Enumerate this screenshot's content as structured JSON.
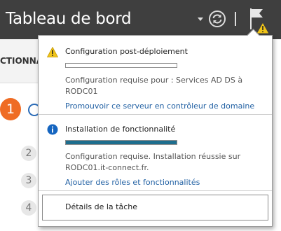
{
  "header": {
    "title": "Tableau de bord",
    "icons": [
      "dropdown-arrow",
      "refresh-icon",
      "flag-icon",
      "warning-badge-icon"
    ]
  },
  "background": {
    "tab_label": "CTIONNA",
    "steps": [
      "1",
      "2",
      "3",
      "4"
    ]
  },
  "notifications": [
    {
      "icon": "warning-icon",
      "title": "Configuration post-déploiement",
      "progress": 0,
      "desc_line1": "Configuration requise pour : Services AD DS à",
      "desc_line2": "RODC01",
      "link": "Promouvoir ce serveur en contrôleur de domaine"
    },
    {
      "icon": "info-icon",
      "title": "Installation de fonctionnalité",
      "progress": 100,
      "desc_line1": "Configuration requise. Installation réussie sur",
      "desc_line2": "RODC01.it-connect.fr.",
      "link": "Ajouter des rôles et fonctionnalités"
    }
  ],
  "task_details_label": "Détails de la tâche",
  "colors": {
    "titlebar": "#3f3f3f",
    "accent_link": "#2160a3",
    "progress_fill": "#1e6e8e",
    "warning": "#f0c419",
    "info": "#1565c0",
    "step_active": "#ef6c24"
  }
}
